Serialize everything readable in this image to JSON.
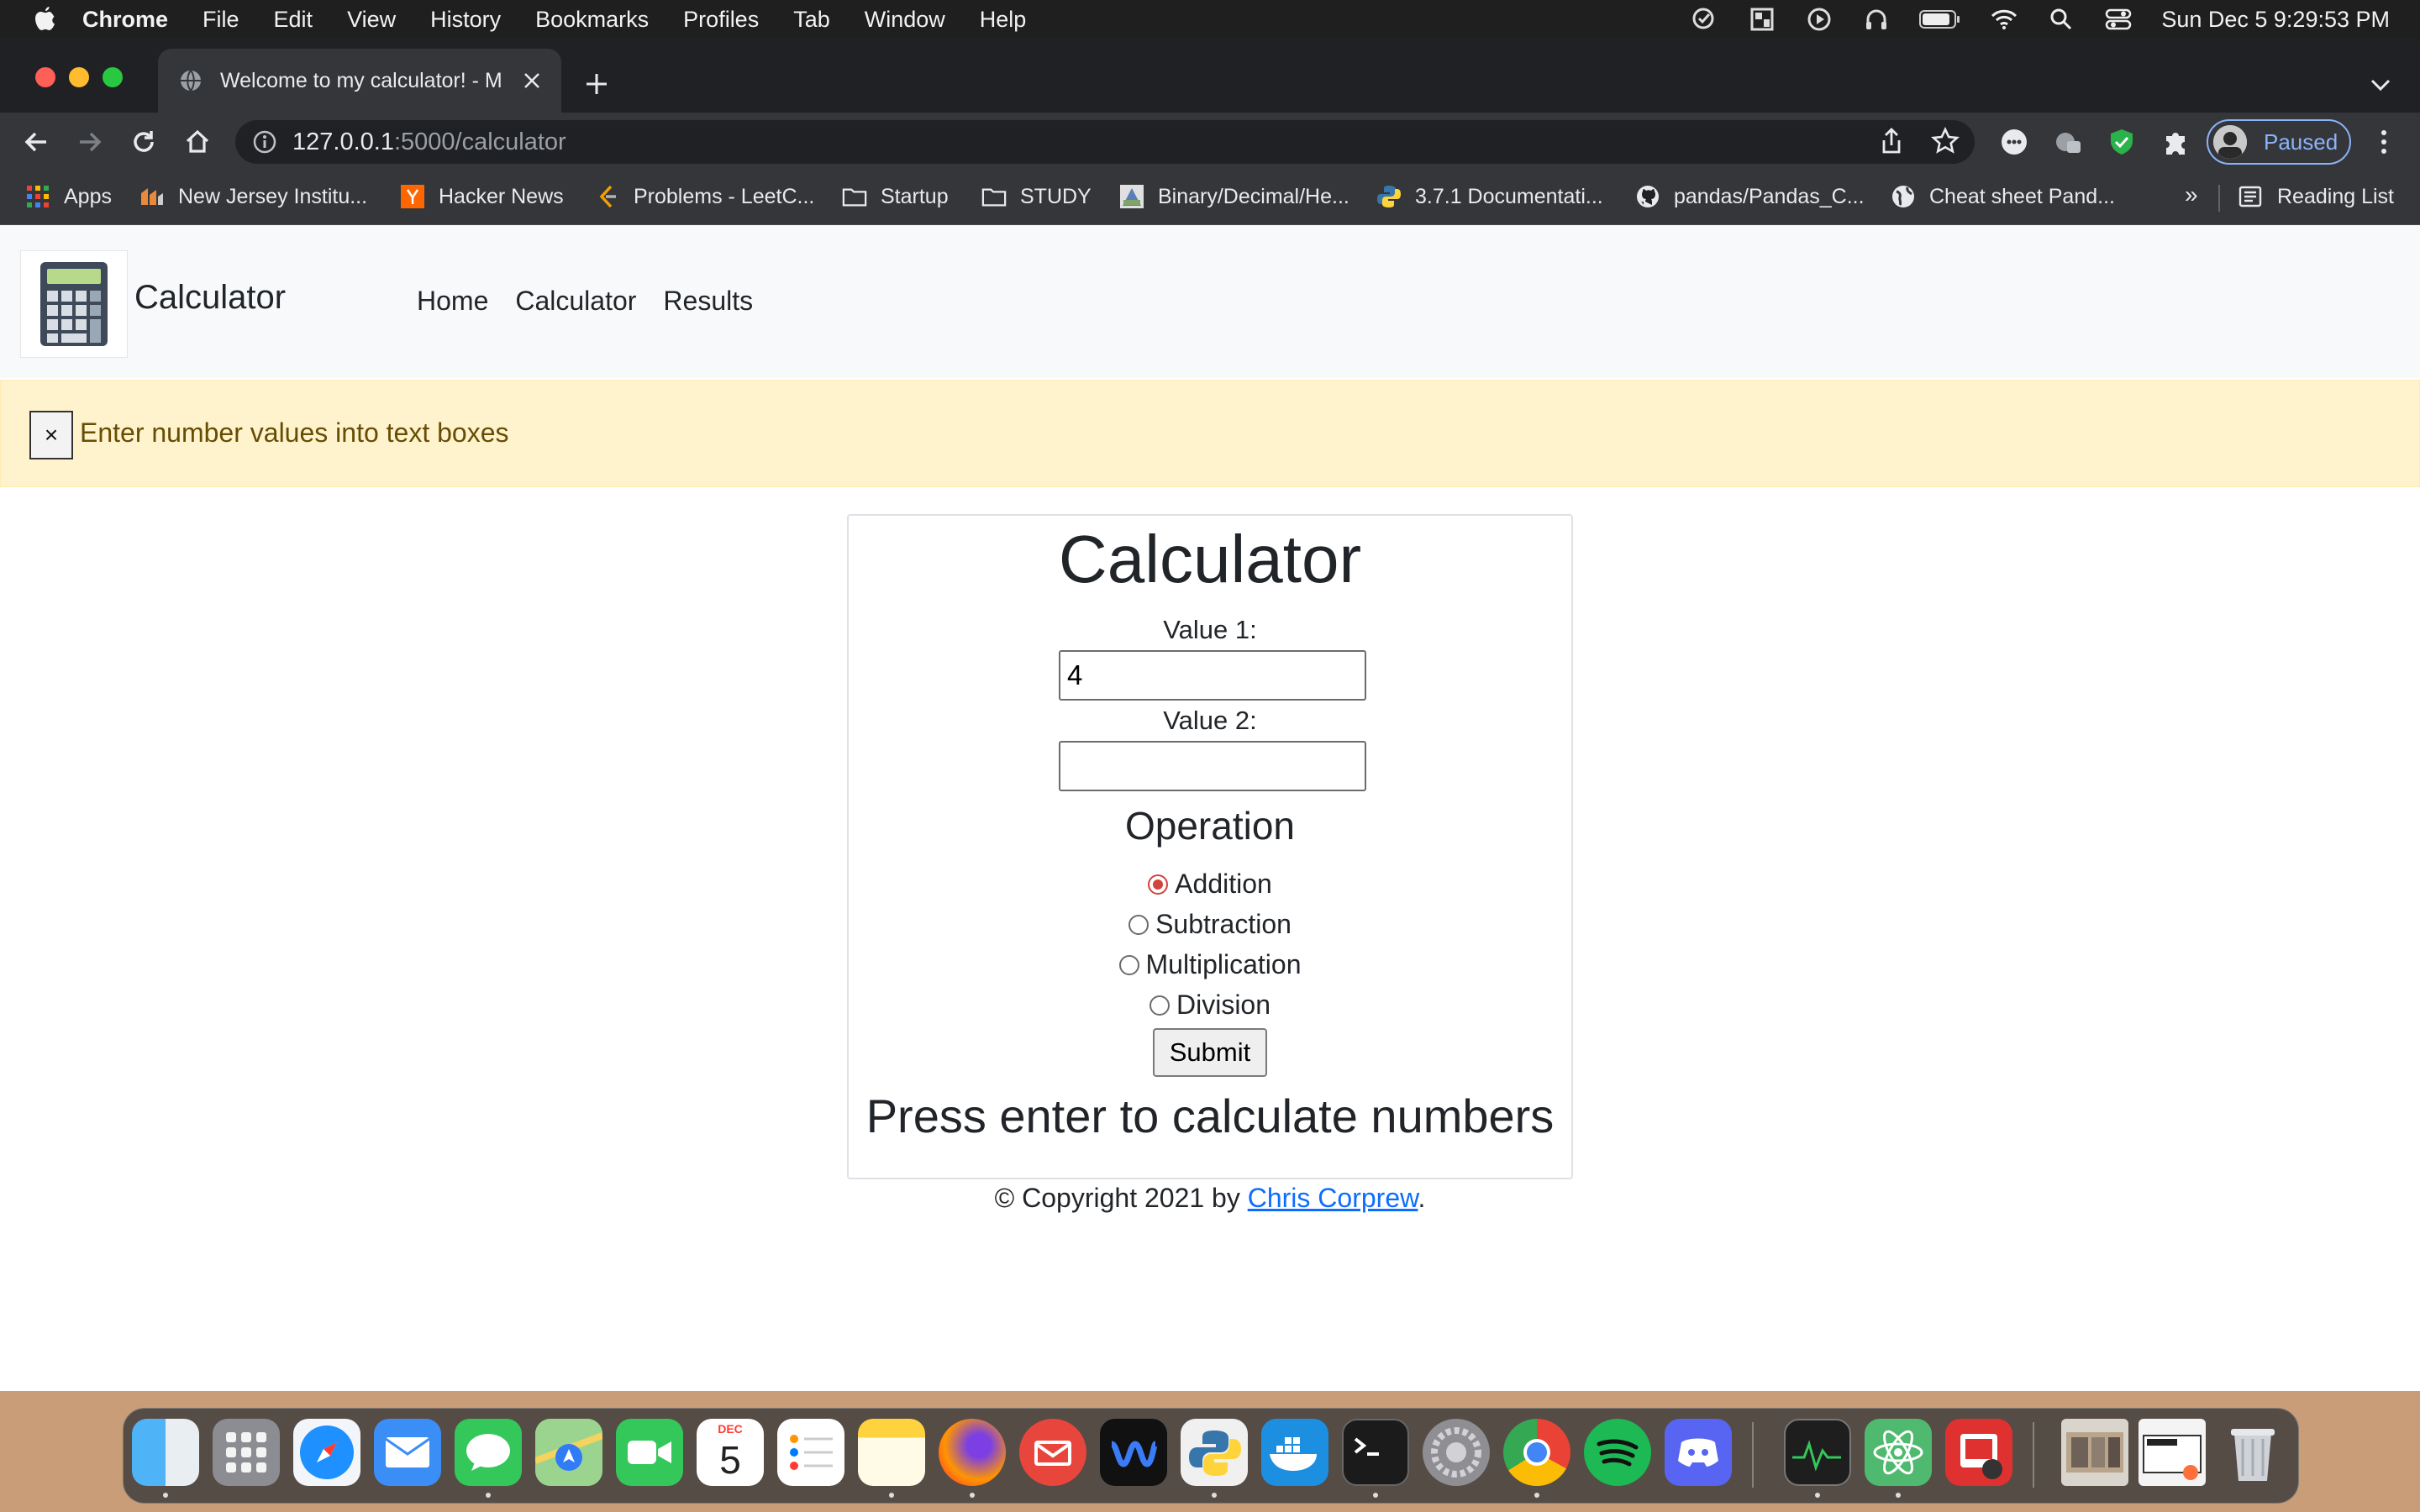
{
  "menubar": {
    "app_name": "Chrome",
    "menus": [
      "File",
      "Edit",
      "View",
      "History",
      "Bookmarks",
      "Profiles",
      "Tab",
      "Window",
      "Help"
    ],
    "clock": "Sun Dec 5  9:29:53 PM"
  },
  "browser": {
    "tab_title": "Welcome to my calculator! - M",
    "url_host": "127.0.0.1",
    "url_path": ":5000/calculator",
    "profile_label": "Paused",
    "bookmarks": [
      "Apps",
      "New Jersey Institu...",
      "Hacker News",
      "Problems - LeetC...",
      "Startup",
      "STUDY",
      "Binary/Decimal/He...",
      "3.7.1 Documentati...",
      "pandas/Pandas_C...",
      "Cheat sheet Pand..."
    ],
    "bookmarks_more": "»",
    "reading_list": "Reading List"
  },
  "page": {
    "brand": "Calculator",
    "nav": [
      "Home",
      "Calculator",
      "Results"
    ],
    "alert": {
      "close": "×",
      "message": "Enter number values into text boxes"
    },
    "calculator": {
      "heading": "Calculator",
      "value1_label": "Value 1:",
      "value1": "4",
      "value2_label": "Value 2:",
      "value2": "",
      "operation_title": "Operation",
      "operations": [
        "Addition",
        "Subtraction",
        "Multiplication",
        "Division"
      ],
      "selected_operation": "Addition",
      "submit_label": "Submit",
      "result_text": "Press enter to calculate numbers"
    },
    "footer": {
      "prefix": "© Copyright 2021 by ",
      "author": "Chris Corprew",
      "suffix": "."
    }
  },
  "dock": {
    "calendar_month": "DEC",
    "calendar_day": "5"
  },
  "colors": {
    "alert_bg": "#fff3cd",
    "alert_text": "#664d03",
    "link": "#0d6efd",
    "radio_accent": "#d2443c",
    "navbar_bg": "#f8f9fa"
  }
}
